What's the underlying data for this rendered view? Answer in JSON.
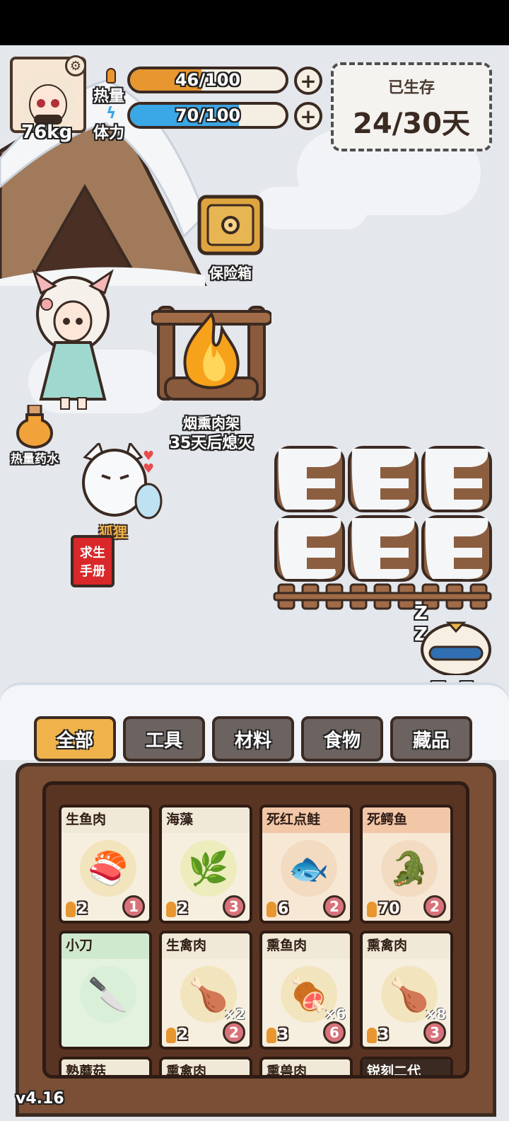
{
  "hud": {
    "weight": "76kg",
    "heat": {
      "label": "热量",
      "value": 46,
      "max": 100,
      "text": "46/100",
      "color": "#e8962f"
    },
    "stamina": {
      "label": "体力",
      "value": 70,
      "max": 100,
      "text": "70/100",
      "color": "#3aa7e6"
    },
    "survive_label": "已生存",
    "survive_value": "24/30天"
  },
  "scene": {
    "safe_label": "保险箱",
    "smoker_label": "烟熏肉架",
    "smoker_status": "35天后熄灭",
    "potion_label": "热量药水",
    "fox_label": "狐狸",
    "manual_label_1": "求生",
    "manual_label_2": "手册",
    "next_day_label": "下一天"
  },
  "tabs": [
    "全部",
    "工具",
    "材料",
    "食物",
    "藏品"
  ],
  "active_tab": 0,
  "items": [
    {
      "name": "生鱼肉",
      "icon": "salmon-steak-icon",
      "glyph": "🍣",
      "cal": "2",
      "days": "1",
      "count": "",
      "header": "#f1e9d8",
      "halo": "#f2e2b8"
    },
    {
      "name": "海藻",
      "icon": "seaweed-icon",
      "glyph": "🌿",
      "cal": "2",
      "days": "3",
      "count": "",
      "header": "#f1e9d8",
      "halo": "#ecebb8"
    },
    {
      "name": "死红点鲑",
      "icon": "dead-fish-icon",
      "glyph": "🐟",
      "cal": "6",
      "days": "2",
      "count": "",
      "header": "#f2c7a8",
      "halo": "#f1d9bf"
    },
    {
      "name": "死鳄鱼",
      "icon": "dead-crocodile-icon",
      "glyph": "🐊",
      "cal": "70",
      "days": "2",
      "count": "",
      "header": "#f2c7a8",
      "halo": "#f1d9bf"
    },
    {
      "name": "小刀",
      "icon": "knife-icon",
      "glyph": "🔪",
      "cal": "",
      "days": "",
      "count": "",
      "header": "#cfe9cf",
      "halo": "#d8eed6"
    },
    {
      "name": "生禽肉",
      "icon": "raw-drumstick-icon",
      "glyph": "🍗",
      "cal": "2",
      "days": "2",
      "count": "×2",
      "header": "#f1e9d8",
      "halo": "#f2e2b8"
    },
    {
      "name": "熏鱼肉",
      "icon": "smoked-fish-icon",
      "glyph": "🍖",
      "cal": "3",
      "days": "6",
      "count": "×6",
      "header": "#f1e9d8",
      "halo": "#f2e2b8"
    },
    {
      "name": "熏禽肉",
      "icon": "smoked-drumstick-icon",
      "glyph": "🍗",
      "cal": "3",
      "days": "3",
      "count": "×8",
      "header": "#f1e9d8",
      "halo": "#f2e2b8"
    }
  ],
  "partial_row": [
    "熟蘑菇",
    "熏禽肉",
    "熏兽肉",
    "锐刻二代"
  ],
  "version": "v4.16"
}
